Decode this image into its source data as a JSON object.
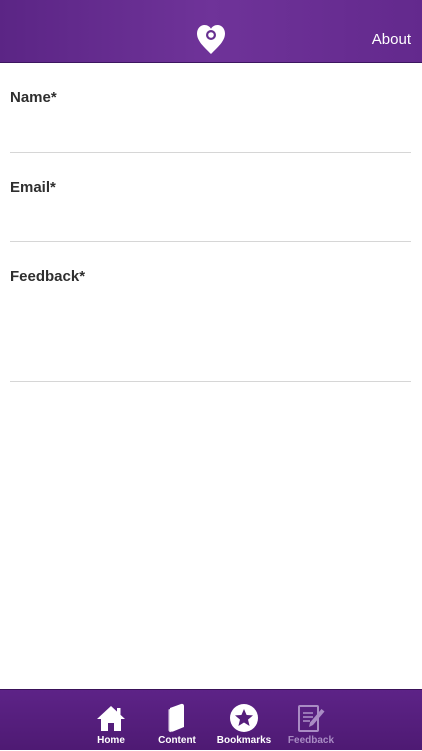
{
  "header": {
    "logo_icon": "heart-pin-icon",
    "about_label": "About"
  },
  "form": {
    "name_label": "Name*",
    "name_value": "",
    "email_label": "Email*",
    "email_value": "",
    "feedback_label": "Feedback*",
    "feedback_value": ""
  },
  "tabbar": {
    "tabs": [
      {
        "label": "Home",
        "icon": "home-icon",
        "active": true
      },
      {
        "label": "Content",
        "icon": "book-icon",
        "active": true
      },
      {
        "label": "Bookmarks",
        "icon": "star-circle-icon",
        "active": true
      },
      {
        "label": "Feedback",
        "icon": "feedback-edit-icon",
        "active": false
      }
    ]
  },
  "colors": {
    "header_purple": "#66308f",
    "tabbar_purple": "#551e7b",
    "inactive_tab": "#a98cc4",
    "divider": "#d6d6d6"
  }
}
